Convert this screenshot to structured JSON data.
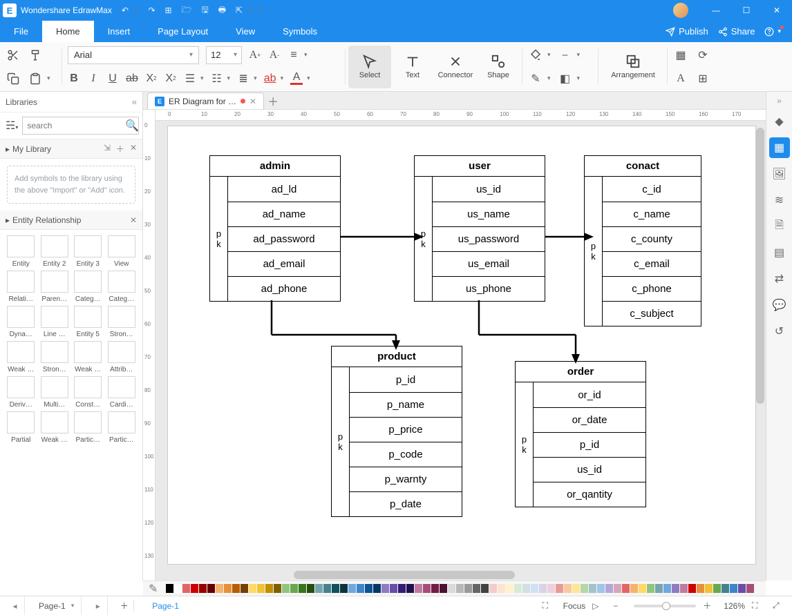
{
  "app": {
    "title": "Wondershare EdrawMax"
  },
  "menubar": {
    "tabs": [
      "File",
      "Home",
      "Insert",
      "Page Layout",
      "View",
      "Symbols"
    ],
    "selected": 1,
    "publish": "Publish",
    "share": "Share"
  },
  "ribbon": {
    "font": "Arial",
    "size": "12",
    "tools": {
      "select": "Select",
      "text": "Text",
      "connector": "Connector",
      "shape": "Shape",
      "arrangement": "Arrangement"
    }
  },
  "leftpanel": {
    "title": "Libraries",
    "search_placeholder": "search",
    "mylib_title": "My Library",
    "placeholder_text": "Add symbols to the library using the above \"Import\" or \"Add\" icon.",
    "section2_title": "Entity Relationship",
    "shapes": [
      "Entity",
      "Entity 2",
      "Entity 3",
      "View",
      "Relati…",
      "Paren…",
      "Categ…",
      "Categ…",
      "Dyna…",
      "Line …",
      "Entity 5",
      "Stron…",
      "Weak …",
      "Stron…",
      "Weak …",
      "Attrib…",
      "Deriv…",
      "Multi…",
      "Const…",
      "Cardi…",
      "Partial",
      "Weak …",
      "Partic…",
      "Partic…"
    ]
  },
  "doc": {
    "tab_label": "ER Diagram for …",
    "page_tab": "Page-1",
    "page_dd": "Page-1"
  },
  "er": {
    "admin": {
      "title": "admin",
      "pk": "pk",
      "fields": [
        "ad_ld",
        "ad_name",
        "ad_password",
        "ad_email",
        "ad_phone"
      ]
    },
    "user": {
      "title": "user",
      "pk": "pk",
      "fields": [
        "us_id",
        "us_name",
        "us_password",
        "us_email",
        "us_phone"
      ]
    },
    "contact": {
      "title": "conact",
      "pk": "pk",
      "fields": [
        "c_id",
        "c_name",
        "c_county",
        "c_email",
        "c_phone",
        "c_subject"
      ]
    },
    "product": {
      "title": "product",
      "pk": "pk",
      "fields": [
        "p_id",
        "p_name",
        "p_price",
        "p_code",
        "p_warnty",
        "p_date"
      ]
    },
    "order": {
      "title": "order",
      "pk": "pk",
      "fields": [
        "or_id",
        "or_date",
        "p_id",
        "us_id",
        "or_qantity"
      ]
    }
  },
  "statusbar": {
    "focus": "Focus",
    "zoom": "126%"
  },
  "ruler_h": [
    "0",
    "10",
    "20",
    "30",
    "40",
    "50",
    "60",
    "70",
    "80",
    "90",
    "100",
    "110",
    "120",
    "130",
    "140",
    "150",
    "160",
    "170"
  ],
  "ruler_v": [
    "0",
    "10",
    "20",
    "30",
    "40",
    "50",
    "60",
    "70",
    "80",
    "90",
    "100",
    "110",
    "120",
    "130"
  ],
  "palette": [
    "#000000",
    "#ffffff",
    "#e06666",
    "#cc0000",
    "#990000",
    "#660000",
    "#f6b26b",
    "#e69138",
    "#b45f06",
    "#783f04",
    "#ffd966",
    "#f1c232",
    "#bf9000",
    "#7f6000",
    "#93c47d",
    "#6aa84f",
    "#38761d",
    "#274e13",
    "#76a5af",
    "#45818e",
    "#134f5c",
    "#0c343d",
    "#6fa8dc",
    "#3d85c6",
    "#0b5394",
    "#073763",
    "#8e7cc3",
    "#674ea7",
    "#351c75",
    "#20124d",
    "#c27ba0",
    "#a64d79",
    "#741b47",
    "#4c1130",
    "#d9d9d9",
    "#b7b7b7",
    "#999999",
    "#666666",
    "#434343",
    "#f4cccc",
    "#fce5cd",
    "#fff2cc",
    "#d9ead3",
    "#d0e0e3",
    "#cfe2f3",
    "#d9d2e9",
    "#ead1dc",
    "#ea9999",
    "#f9cb9c",
    "#ffe599",
    "#b6d7a8",
    "#a2c4c9",
    "#9fc5e8",
    "#b4a7d6",
    "#d5a6bd",
    "#e06666",
    "#f6b26b",
    "#ffd966",
    "#93c47d",
    "#76a5af",
    "#6fa8dc",
    "#8e7cc3",
    "#c27ba0",
    "#cc0000",
    "#e69138",
    "#f1c232",
    "#6aa84f",
    "#45818e",
    "#3d85c6",
    "#674ea7",
    "#a64d79"
  ]
}
